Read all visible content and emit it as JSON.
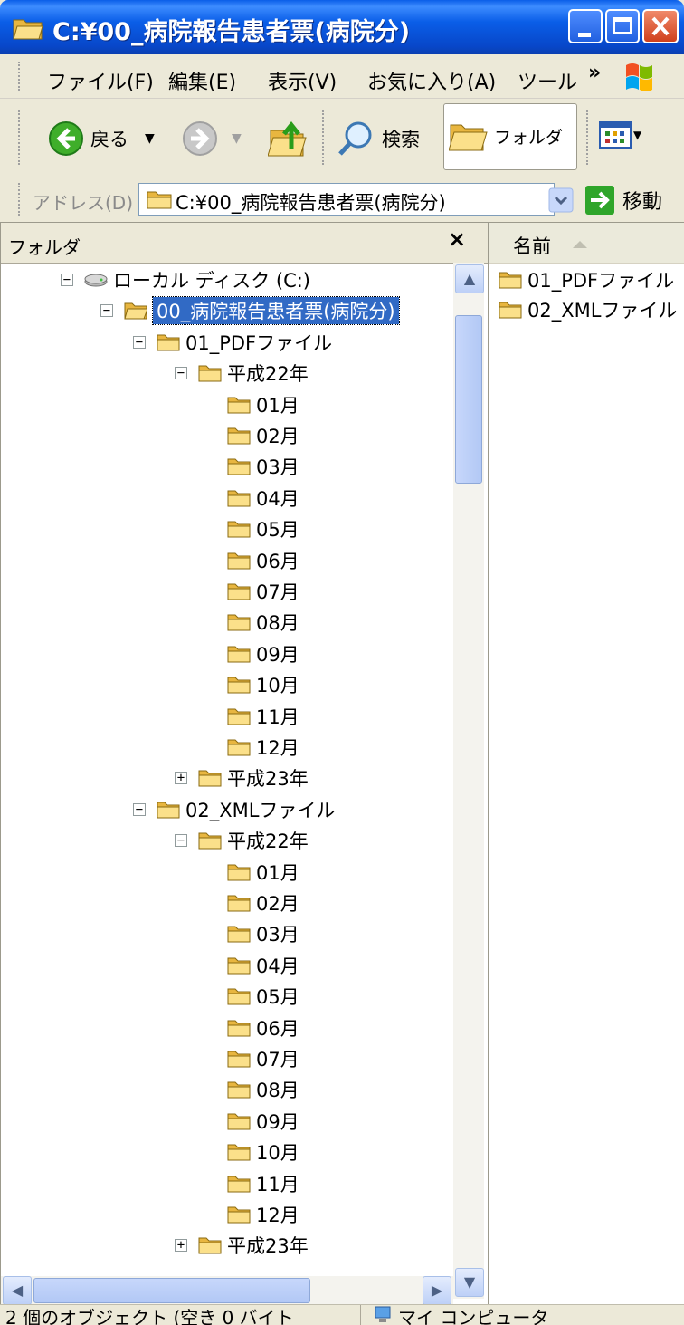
{
  "window": {
    "title": "C:¥00_病院報告患者票(病院分)"
  },
  "menu": {
    "items": [
      "ファイル(F)",
      "編集(E)",
      "表示(V)",
      "お気に入り(A)",
      "ツール"
    ],
    "more": "»"
  },
  "toolbar": {
    "back": "戻る",
    "search": "検索",
    "folders": "フォルダ"
  },
  "address": {
    "label": "アドレス(D)",
    "value": "C:¥00_病院報告患者票(病院分)",
    "go": "移動"
  },
  "folder_pane": {
    "title": "フォルダ",
    "close": "×",
    "tree": [
      {
        "label": "ローカル ディスク (C:)",
        "level": 0,
        "expander": "minus",
        "icon": "drive"
      },
      {
        "label": "00_病院報告患者票(病院分)",
        "level": 1,
        "expander": "minus",
        "icon": "folder-open",
        "selected": true
      },
      {
        "label": "01_PDFファイル",
        "level": 2,
        "expander": "minus",
        "icon": "folder"
      },
      {
        "label": "平成22年",
        "level": 3,
        "expander": "minus",
        "icon": "folder"
      },
      {
        "label": "01月",
        "level": 4,
        "expander": "none",
        "icon": "folder"
      },
      {
        "label": "02月",
        "level": 4,
        "expander": "none",
        "icon": "folder"
      },
      {
        "label": "03月",
        "level": 4,
        "expander": "none",
        "icon": "folder"
      },
      {
        "label": "04月",
        "level": 4,
        "expander": "none",
        "icon": "folder"
      },
      {
        "label": "05月",
        "level": 4,
        "expander": "none",
        "icon": "folder"
      },
      {
        "label": "06月",
        "level": 4,
        "expander": "none",
        "icon": "folder"
      },
      {
        "label": "07月",
        "level": 4,
        "expander": "none",
        "icon": "folder"
      },
      {
        "label": "08月",
        "level": 4,
        "expander": "none",
        "icon": "folder"
      },
      {
        "label": "09月",
        "level": 4,
        "expander": "none",
        "icon": "folder"
      },
      {
        "label": "10月",
        "level": 4,
        "expander": "none",
        "icon": "folder"
      },
      {
        "label": "11月",
        "level": 4,
        "expander": "none",
        "icon": "folder"
      },
      {
        "label": "12月",
        "level": 4,
        "expander": "none",
        "icon": "folder"
      },
      {
        "label": "平成23年",
        "level": 3,
        "expander": "plus",
        "icon": "folder"
      },
      {
        "label": "02_XMLファイル",
        "level": 2,
        "expander": "minus",
        "icon": "folder"
      },
      {
        "label": "平成22年",
        "level": 3,
        "expander": "minus",
        "icon": "folder"
      },
      {
        "label": "01月",
        "level": 4,
        "expander": "none",
        "icon": "folder"
      },
      {
        "label": "02月",
        "level": 4,
        "expander": "none",
        "icon": "folder"
      },
      {
        "label": "03月",
        "level": 4,
        "expander": "none",
        "icon": "folder"
      },
      {
        "label": "04月",
        "level": 4,
        "expander": "none",
        "icon": "folder"
      },
      {
        "label": "05月",
        "level": 4,
        "expander": "none",
        "icon": "folder"
      },
      {
        "label": "06月",
        "level": 4,
        "expander": "none",
        "icon": "folder"
      },
      {
        "label": "07月",
        "level": 4,
        "expander": "none",
        "icon": "folder"
      },
      {
        "label": "08月",
        "level": 4,
        "expander": "none",
        "icon": "folder"
      },
      {
        "label": "09月",
        "level": 4,
        "expander": "none",
        "icon": "folder"
      },
      {
        "label": "10月",
        "level": 4,
        "expander": "none",
        "icon": "folder"
      },
      {
        "label": "11月",
        "level": 4,
        "expander": "none",
        "icon": "folder"
      },
      {
        "label": "12月",
        "level": 4,
        "expander": "none",
        "icon": "folder"
      },
      {
        "label": "平成23年",
        "level": 3,
        "expander": "plus",
        "icon": "folder"
      }
    ]
  },
  "file_list": {
    "column": "名前",
    "items": [
      "01_PDFファイル",
      "02_XMLファイル"
    ]
  },
  "status": {
    "objects": "2 個のオブジェクト (空き 0 バイト",
    "location": "マイ コンピュータ"
  },
  "colors": {
    "titlebar": "#0a5ee8",
    "selection": "#316ac5",
    "folder": "#f5d46b",
    "chrome": "#ece9d8"
  }
}
